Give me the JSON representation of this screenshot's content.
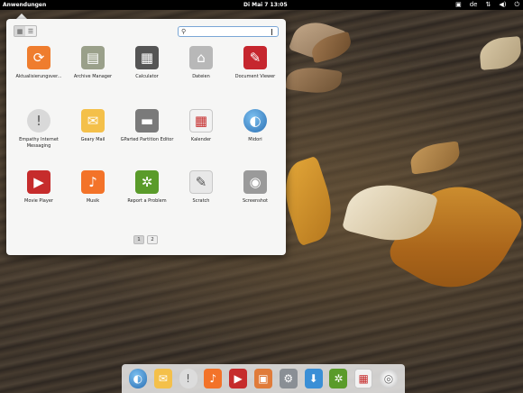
{
  "top_panel": {
    "apps_menu": "Anwendungen",
    "clock": "Di Mai  7 13:05",
    "keyboard_layout": "de"
  },
  "launcher": {
    "search": {
      "value": "",
      "placeholder": ""
    },
    "apps": [
      {
        "label": "Aktualisierungsver...",
        "icon": "refresh-icon",
        "color": "#ef7d2e"
      },
      {
        "label": "Archive Manager",
        "icon": "archive-icon",
        "color": "#9aa08a"
      },
      {
        "label": "Calculator",
        "icon": "calculator-icon",
        "color": "#555555"
      },
      {
        "label": "Dateien",
        "icon": "home-folder-icon",
        "color": "#b8b8b8"
      },
      {
        "label": "Document Viewer",
        "icon": "document-viewer-icon",
        "color": "#c6262e"
      },
      {
        "label": "Empathy Internet Messaging",
        "icon": "chat-bubble-icon",
        "color": "#d9d9d9"
      },
      {
        "label": "Geary Mail",
        "icon": "mail-icon",
        "color": "#f4c04a"
      },
      {
        "label": "GParted Partition Editor",
        "icon": "disk-icon",
        "color": "#7a7a7a"
      },
      {
        "label": "Kalender",
        "icon": "calendar-icon",
        "color": "#f2f2f2"
      },
      {
        "label": "Midori",
        "icon": "globe-icon",
        "color": "#3a87c8"
      },
      {
        "label": "Movie Player",
        "icon": "film-icon",
        "color": "#c62c2c"
      },
      {
        "label": "Musik",
        "icon": "music-note-icon",
        "color": "#f37329"
      },
      {
        "label": "Report a Problem",
        "icon": "ladybug-icon",
        "color": "#5a9b2a"
      },
      {
        "label": "Scratch",
        "icon": "text-editor-icon",
        "color": "#e8e8e8"
      },
      {
        "label": "Screenshot",
        "icon": "camera-icon",
        "color": "#9a9a9a"
      }
    ],
    "pages": [
      "1",
      "2"
    ],
    "current_page": "1"
  },
  "dock": {
    "items": [
      {
        "name": "dock-midori",
        "icon": "globe-icon",
        "color": "#3a87c8"
      },
      {
        "name": "dock-geary-mail",
        "icon": "mail-icon",
        "color": "#f4c04a"
      },
      {
        "name": "dock-empathy",
        "icon": "chat-bubble-icon",
        "color": "#dcdcdc"
      },
      {
        "name": "dock-musik",
        "icon": "music-note-icon",
        "color": "#f37329"
      },
      {
        "name": "dock-movie-player",
        "icon": "film-icon",
        "color": "#c62c2c"
      },
      {
        "name": "dock-shotwell",
        "icon": "photos-icon",
        "color": "#e07b39"
      },
      {
        "name": "dock-settings",
        "icon": "settings-icon",
        "color": "#8a8f95"
      },
      {
        "name": "dock-software-center",
        "icon": "download-icon",
        "color": "#3a8fd6"
      },
      {
        "name": "dock-report-problem",
        "icon": "ladybug-icon",
        "color": "#5a9b2a"
      },
      {
        "name": "dock-kalender",
        "icon": "calendar-icon",
        "color": "#f2f2f2"
      },
      {
        "name": "dock-disc",
        "icon": "disc-icon",
        "color": "#e6e6e6"
      }
    ]
  }
}
